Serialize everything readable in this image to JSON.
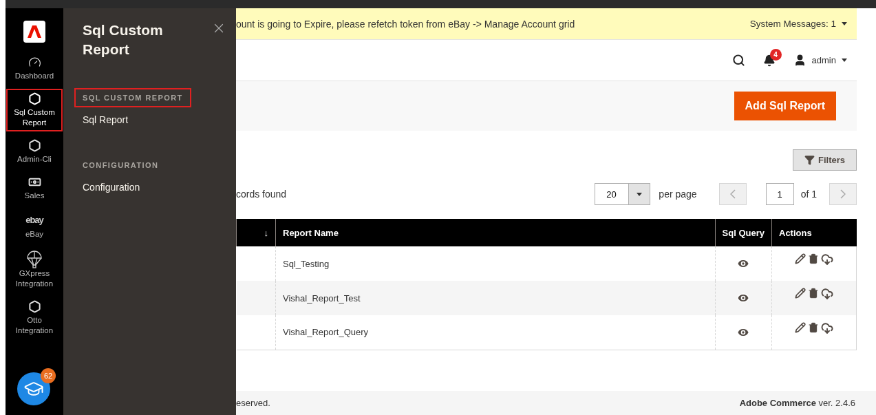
{
  "nav": {
    "items": [
      {
        "kind": "icon",
        "label": "Dashboard",
        "selected": false,
        "highlighted": false
      },
      {
        "kind": "icon",
        "label": "Sql Custom Report",
        "selected": true,
        "highlighted": true
      },
      {
        "kind": "icon",
        "label": "Admin-Cli",
        "selected": false,
        "highlighted": false
      },
      {
        "kind": "icon",
        "label": "Sales",
        "selected": false,
        "highlighted": false
      },
      {
        "kind": "logo",
        "logo": "ebay",
        "label": "eBay",
        "selected": false,
        "highlighted": false
      },
      {
        "kind": "icon",
        "label": "GXpress Integration",
        "selected": false,
        "highlighted": false
      },
      {
        "kind": "icon",
        "label": "Otto Integration",
        "selected": false,
        "highlighted": false
      }
    ],
    "learning_badge": "62"
  },
  "flyout": {
    "title": "Sql Custom Report",
    "sections": [
      {
        "heading": "SQL CUSTOM REPORT",
        "highlighted": true,
        "links": [
          "Sql Report"
        ]
      },
      {
        "heading": "CONFIGURATION",
        "highlighted": false,
        "links": [
          "Configuration"
        ]
      }
    ]
  },
  "message_bar": {
    "text": "ount is going to Expire, please refetch token from eBay -> Manage Account grid",
    "system_messages": "System Messages: 1"
  },
  "header": {
    "notifications": "4",
    "user": "admin"
  },
  "actions": {
    "primary": "Add Sql Report"
  },
  "grid": {
    "filters": "Filters",
    "records": "cords found",
    "per_page": "20",
    "per_page_label": "per page",
    "page": "1",
    "of": "of 1",
    "columns": [
      "↓",
      "Report Name",
      "Sql Query",
      "Actions"
    ],
    "rows": [
      {
        "report_name": "Sql_Testing"
      },
      {
        "report_name": "Vishal_Report_Test"
      },
      {
        "report_name": "Vishal_Report_Query"
      }
    ]
  },
  "footer": {
    "left": "eserved.",
    "right": "**Adobe Commerce** ver. 2.4.6"
  }
}
